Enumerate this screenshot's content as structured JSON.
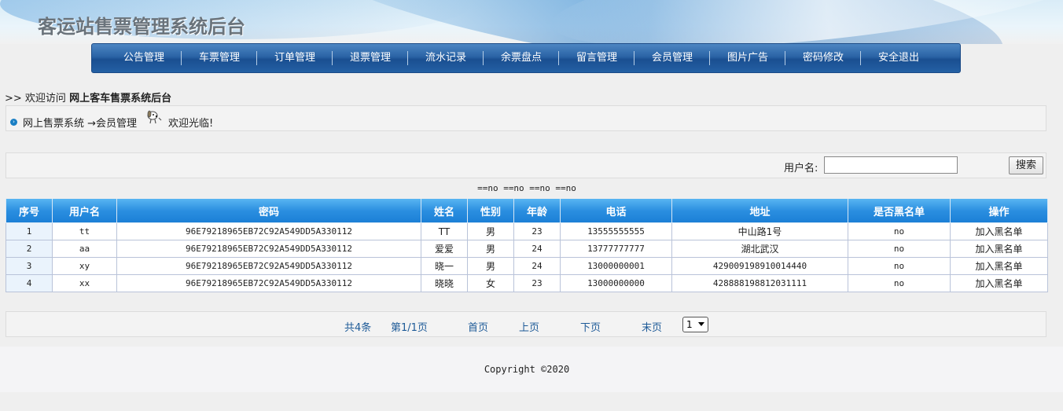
{
  "header": {
    "title": "客运站售票管理系统后台"
  },
  "nav": {
    "items": [
      "公告管理",
      "车票管理",
      "订单管理",
      "退票管理",
      "流水记录",
      "余票盘点",
      "留言管理",
      "会员管理",
      "图片广告",
      "密码修改",
      "安全退出"
    ]
  },
  "welcome": {
    "prefix": ">> 欢迎访问",
    "site": "网上客车售票系统后台"
  },
  "breadcrumb": {
    "path": "网上售票系统 →会员管理",
    "greeting": "欢迎光临!"
  },
  "search": {
    "label": "用户名:",
    "value": "",
    "button": "搜索"
  },
  "status_line": "==no ==no ==no ==no",
  "table": {
    "headers": [
      "序号",
      "用户名",
      "密码",
      "姓名",
      "性别",
      "年龄",
      "电话",
      "地址",
      "是否黑名单",
      "操作"
    ],
    "rows": [
      [
        "1",
        "tt",
        "96E79218965EB72C92A549DD5A330112",
        "TT",
        "男",
        "23",
        "13555555555",
        "中山路1号",
        "no",
        "加入黑名单"
      ],
      [
        "2",
        "aa",
        "96E79218965EB72C92A549DD5A330112",
        "爱爱",
        "男",
        "24",
        "13777777777",
        "湖北武汉",
        "no",
        "加入黑名单"
      ],
      [
        "3",
        "xy",
        "96E79218965EB72C92A549DD5A330112",
        "晓一",
        "男",
        "24",
        "13000000001",
        "429009198910014440",
        "no",
        "加入黑名单"
      ],
      [
        "4",
        "xx",
        "96E79218965EB72C92A549DD5A330112",
        "晓晓",
        "女",
        "23",
        "13000000000",
        "428888198812031111",
        "no",
        "加入黑名单"
      ]
    ]
  },
  "pager": {
    "total": "共4条",
    "page": "第1/1页",
    "first": "首页",
    "prev": "上页",
    "next": "下页",
    "last": "末页",
    "selected_page": "1"
  },
  "footer": {
    "copyright": "Copyright ©2020"
  }
}
